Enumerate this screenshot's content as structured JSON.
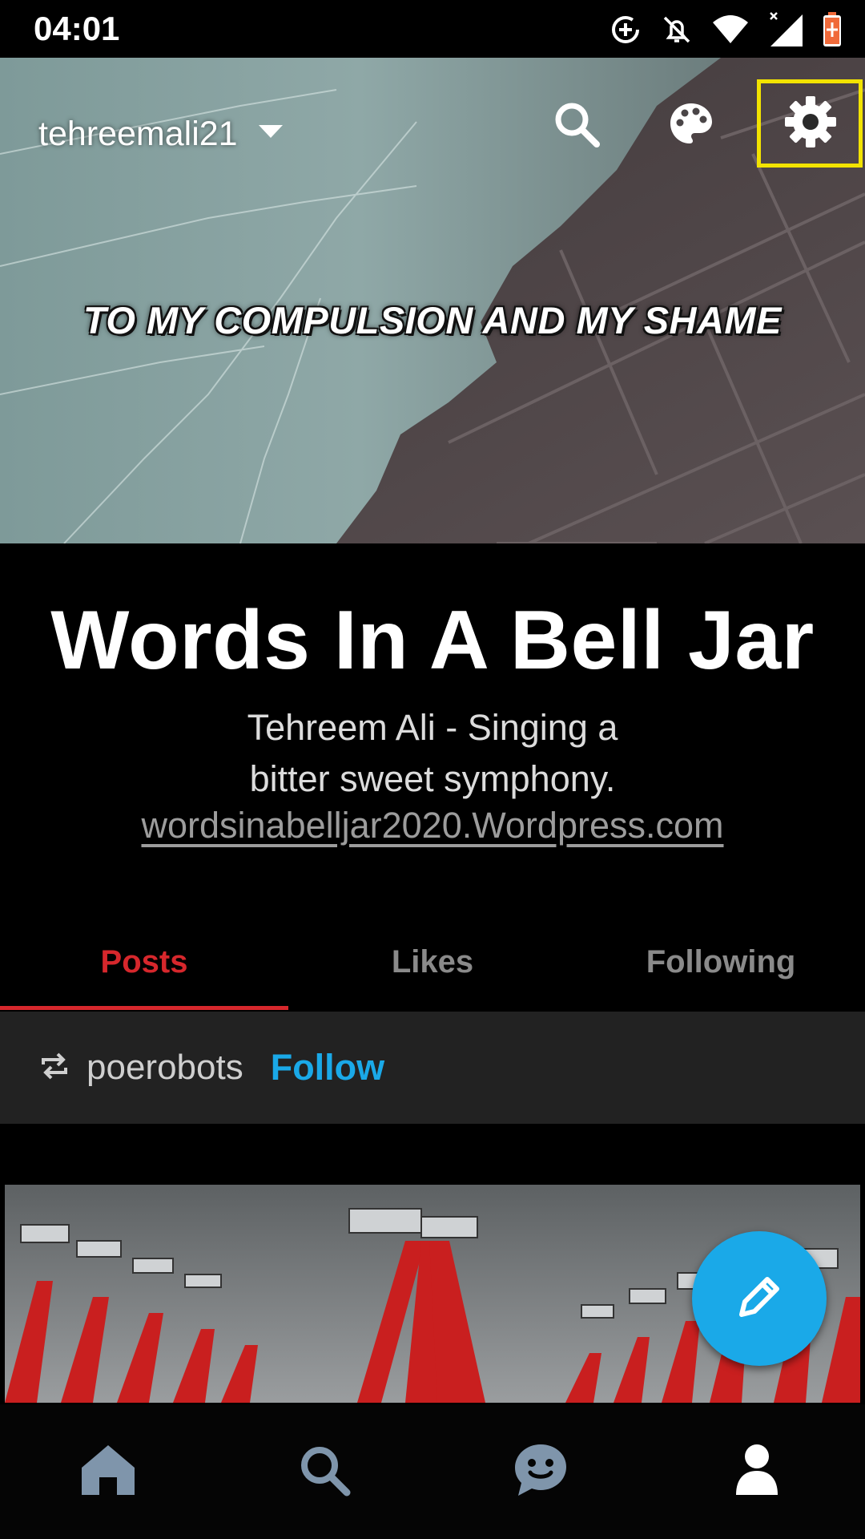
{
  "status_bar": {
    "time": "04:01",
    "icons": [
      "data-saver-icon",
      "notifications-off-icon",
      "wifi-icon",
      "signal-icon",
      "battery-charging-icon"
    ]
  },
  "header": {
    "account_name": "tehreemali21",
    "quote": "TO MY COMPULSION AND MY SHAME",
    "actions": [
      "search-icon",
      "palette-icon",
      "gear-icon"
    ],
    "highlight_color": "#f2e300"
  },
  "blog": {
    "title": "Words In A Bell Jar",
    "description_line1": "Tehreem Ali - Singing a",
    "description_line2": "bitter sweet symphony.",
    "link": "wordsinabelljar2020.Wordpress.com"
  },
  "tabs": [
    {
      "label": "Posts",
      "active": true
    },
    {
      "label": "Likes",
      "active": false
    },
    {
      "label": "Following",
      "active": false
    }
  ],
  "reblog": {
    "icon": "reblog-icon",
    "blog_name": "poerobots",
    "follow_label": "Follow"
  },
  "fab": {
    "icon": "pencil-icon"
  },
  "bottom_nav": [
    "home-icon",
    "search-icon",
    "chat-icon",
    "account-icon"
  ],
  "colors": {
    "accent_red": "#d6272c",
    "accent_blue": "#1aa9e8",
    "background": "#000000"
  }
}
